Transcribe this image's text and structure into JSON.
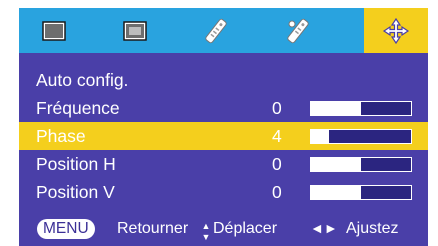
{
  "colors": {
    "panel": "#4a3fa8",
    "tab_bar": "#29a3df",
    "highlight": "#f4cf1d",
    "text": "#ffffff",
    "bar_track": "#2b2580"
  },
  "tabs": [
    {
      "icon": "picture-icon",
      "active": false
    },
    {
      "icon": "screen-icon",
      "active": false
    },
    {
      "icon": "settings-remote-icon",
      "active": false
    },
    {
      "icon": "options-remote-icon",
      "active": false
    },
    {
      "icon": "position-move-icon",
      "active": true
    }
  ],
  "menu": {
    "items": [
      {
        "label": "Auto config.",
        "value": null,
        "level": null,
        "selected": false
      },
      {
        "label": "Fréquence",
        "value": "0",
        "level": 0.5,
        "selected": false
      },
      {
        "label": "Phase",
        "value": "4",
        "level": 0.18,
        "selected": true
      },
      {
        "label": "Position H",
        "value": "0",
        "level": 0.5,
        "selected": false
      },
      {
        "label": "Position V",
        "value": "0",
        "level": 0.5,
        "selected": false
      }
    ]
  },
  "footer": {
    "menu_key": "MENU",
    "back_label": "Retourner",
    "move_glyph": "▲▼",
    "move_label": "Déplacer",
    "adjust_glyph": "◄►",
    "adjust_label": "Ajustez"
  }
}
